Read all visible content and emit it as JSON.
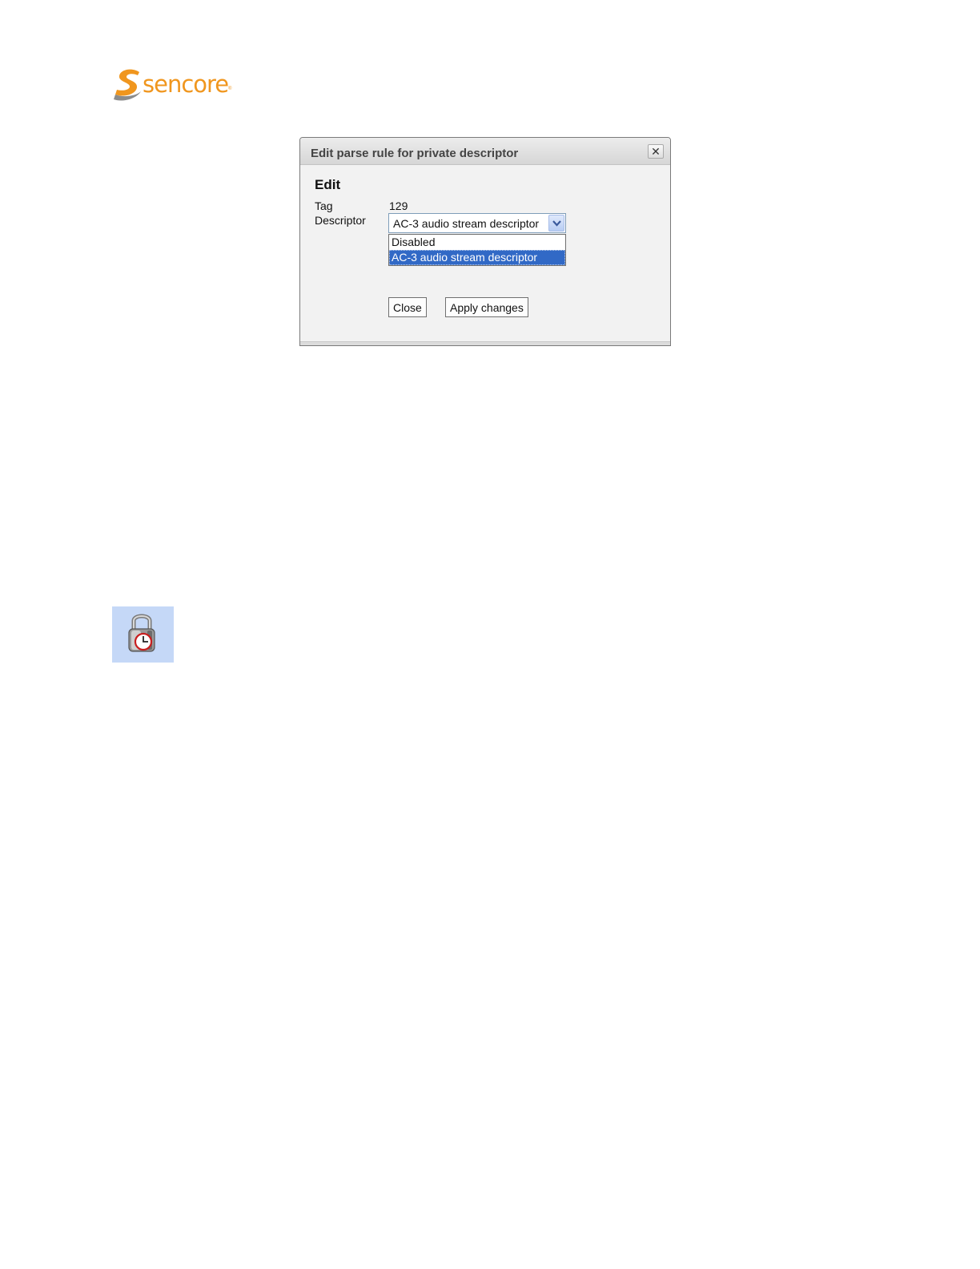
{
  "brand": {
    "logo_text": "sencore",
    "registered_mark": "®",
    "color": "#f0961e",
    "mark_color": "#8c8c8c"
  },
  "dialog": {
    "title": "Edit parse rule for private descriptor",
    "close_icon": "close-icon",
    "close_glyph": "✕",
    "heading": "Edit",
    "tag_label": "Tag",
    "tag_value": "129",
    "descriptor_label": "Descriptor",
    "descriptor_selected": "AC-3 audio stream descriptor",
    "descriptor_options": [
      {
        "label": "Disabled",
        "selected": false
      },
      {
        "label": "AC-3 audio stream descriptor",
        "selected": true
      }
    ],
    "selection_color": "#3169c6",
    "close_button_label": "Close",
    "apply_button_label": "Apply changes"
  },
  "lock_icon": {
    "icon": "timed-lock-icon",
    "background": "#c5d8f7"
  }
}
